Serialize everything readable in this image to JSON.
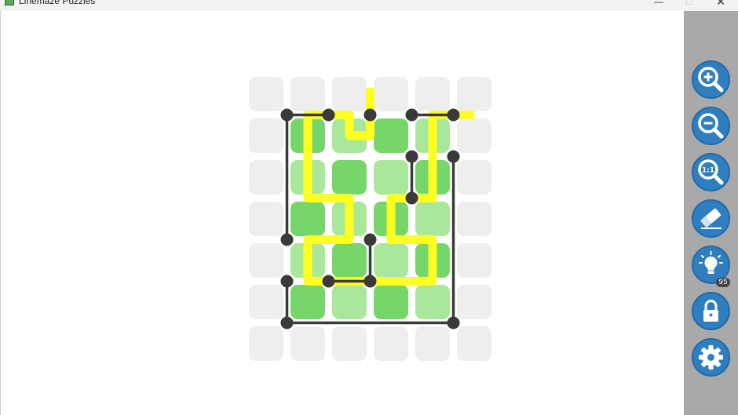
{
  "window": {
    "title": "Linemaze Puzzles",
    "controls": {
      "minimize": "—",
      "maximize": "☐",
      "close": "✕"
    }
  },
  "colors": {
    "empty_tile": "#eeeeee",
    "tile_dark_green": "#77d66a",
    "tile_light_green": "#a9e89a",
    "path": "#ffff22",
    "wall": "#3a3a3a",
    "toolbar_bg": "#a9a9a9",
    "tool_button": "#2f7fc0"
  },
  "puzzle": {
    "grid": {
      "cols": 6,
      "rows": 7
    },
    "tiles": [
      "eeeeee",
      "eDLDLe",
      "eLDLDe",
      "eDLDLe",
      "eLDLDe",
      "eDLDLe",
      "eeeeee"
    ],
    "path": [
      [
        3,
        0.35
      ],
      [
        3,
        1.5
      ],
      [
        2.5,
        1.5
      ],
      [
        2.5,
        1
      ],
      [
        1.5,
        1
      ],
      [
        1.5,
        3
      ],
      [
        2.5,
        3
      ],
      [
        2.5,
        4
      ],
      [
        1.5,
        4
      ],
      [
        1.5,
        5
      ],
      [
        4.5,
        5
      ],
      [
        4.5,
        4
      ],
      [
        3.5,
        4
      ],
      [
        3.5,
        3
      ],
      [
        4.5,
        3
      ],
      [
        4.5,
        1
      ],
      [
        5.5,
        1
      ]
    ],
    "walls": [
      [
        [
          1,
          1
        ],
        [
          2,
          1
        ]
      ],
      [
        [
          4,
          1
        ],
        [
          5,
          1
        ]
      ],
      [
        [
          1,
          1
        ],
        [
          1,
          4
        ]
      ],
      [
        [
          4,
          2
        ],
        [
          4,
          3
        ]
      ],
      [
        [
          5,
          2
        ],
        [
          5,
          6
        ]
      ],
      [
        [
          3,
          4
        ],
        [
          3,
          5
        ]
      ],
      [
        [
          2,
          5
        ],
        [
          3,
          5
        ]
      ],
      [
        [
          1,
          5
        ],
        [
          1,
          6
        ]
      ],
      [
        [
          1,
          6
        ],
        [
          5,
          6
        ]
      ]
    ],
    "dots": [
      [
        1,
        1
      ],
      [
        2,
        1
      ],
      [
        3,
        1
      ],
      [
        4,
        1
      ],
      [
        5,
        1
      ],
      [
        4,
        2
      ],
      [
        5,
        2
      ],
      [
        4,
        3
      ],
      [
        1,
        4
      ],
      [
        3,
        4
      ],
      [
        1,
        5
      ],
      [
        2,
        5
      ],
      [
        3,
        5
      ],
      [
        1,
        6
      ],
      [
        5,
        6
      ]
    ]
  },
  "toolbar": {
    "buttons": [
      {
        "name": "zoom-in",
        "icon": "zoom-in-icon"
      },
      {
        "name": "zoom-out",
        "icon": "zoom-out-icon"
      },
      {
        "name": "zoom-reset",
        "icon": "zoom-actual-size-icon",
        "label": "1:1"
      },
      {
        "name": "eraser",
        "icon": "eraser-icon"
      },
      {
        "name": "hint",
        "icon": "lightbulb-icon"
      },
      {
        "name": "lock",
        "icon": "lock-icon"
      },
      {
        "name": "settings",
        "icon": "gear-icon"
      }
    ],
    "hint_count": "95"
  }
}
